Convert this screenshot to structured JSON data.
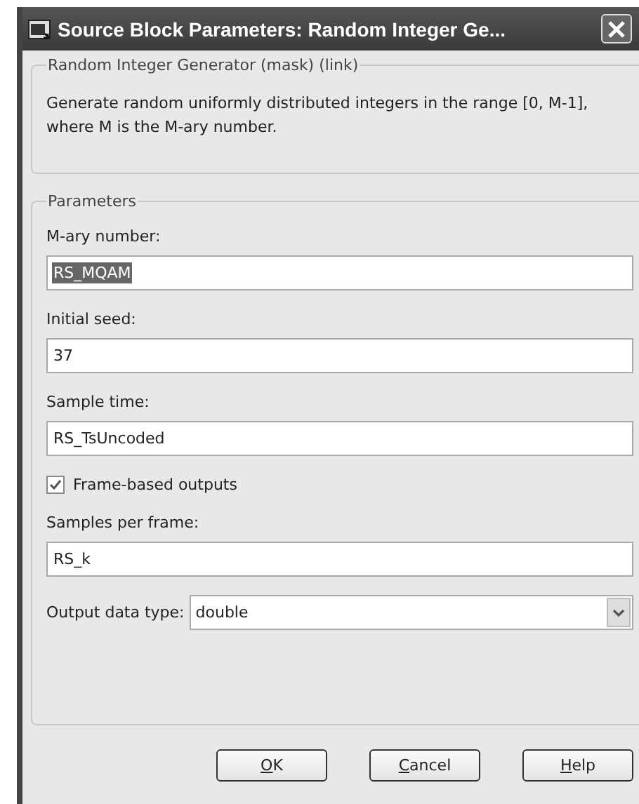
{
  "window": {
    "title": "Source Block Parameters: Random Integer Ge..."
  },
  "description_group": {
    "title": "Random Integer Generator (mask) (link)",
    "text": "Generate random uniformly distributed integers in the range [0, M-1], where M is the M-ary number."
  },
  "parameters": {
    "title": "Parameters",
    "items": [
      {
        "kind": "text",
        "label": "M-ary number:",
        "value": "RS_MQAM",
        "selected": true
      },
      {
        "kind": "text",
        "label": "Initial seed:",
        "value": "37",
        "selected": false
      },
      {
        "kind": "text",
        "label": "Sample time:",
        "value": "RS_TsUncoded",
        "selected": false
      },
      {
        "kind": "checkbox",
        "label": "Frame-based outputs",
        "checked": true
      },
      {
        "kind": "text",
        "label": "Samples per frame:",
        "value": "RS_k",
        "selected": false
      },
      {
        "kind": "dropdown",
        "label": "Output data type:",
        "value": "double"
      }
    ]
  },
  "buttons": [
    {
      "label": "OK",
      "mnemonic_underlined": true
    },
    {
      "label": "Cancel",
      "mnemonic_underlined": true
    },
    {
      "label": "Help",
      "mnemonic_underlined": true
    }
  ]
}
